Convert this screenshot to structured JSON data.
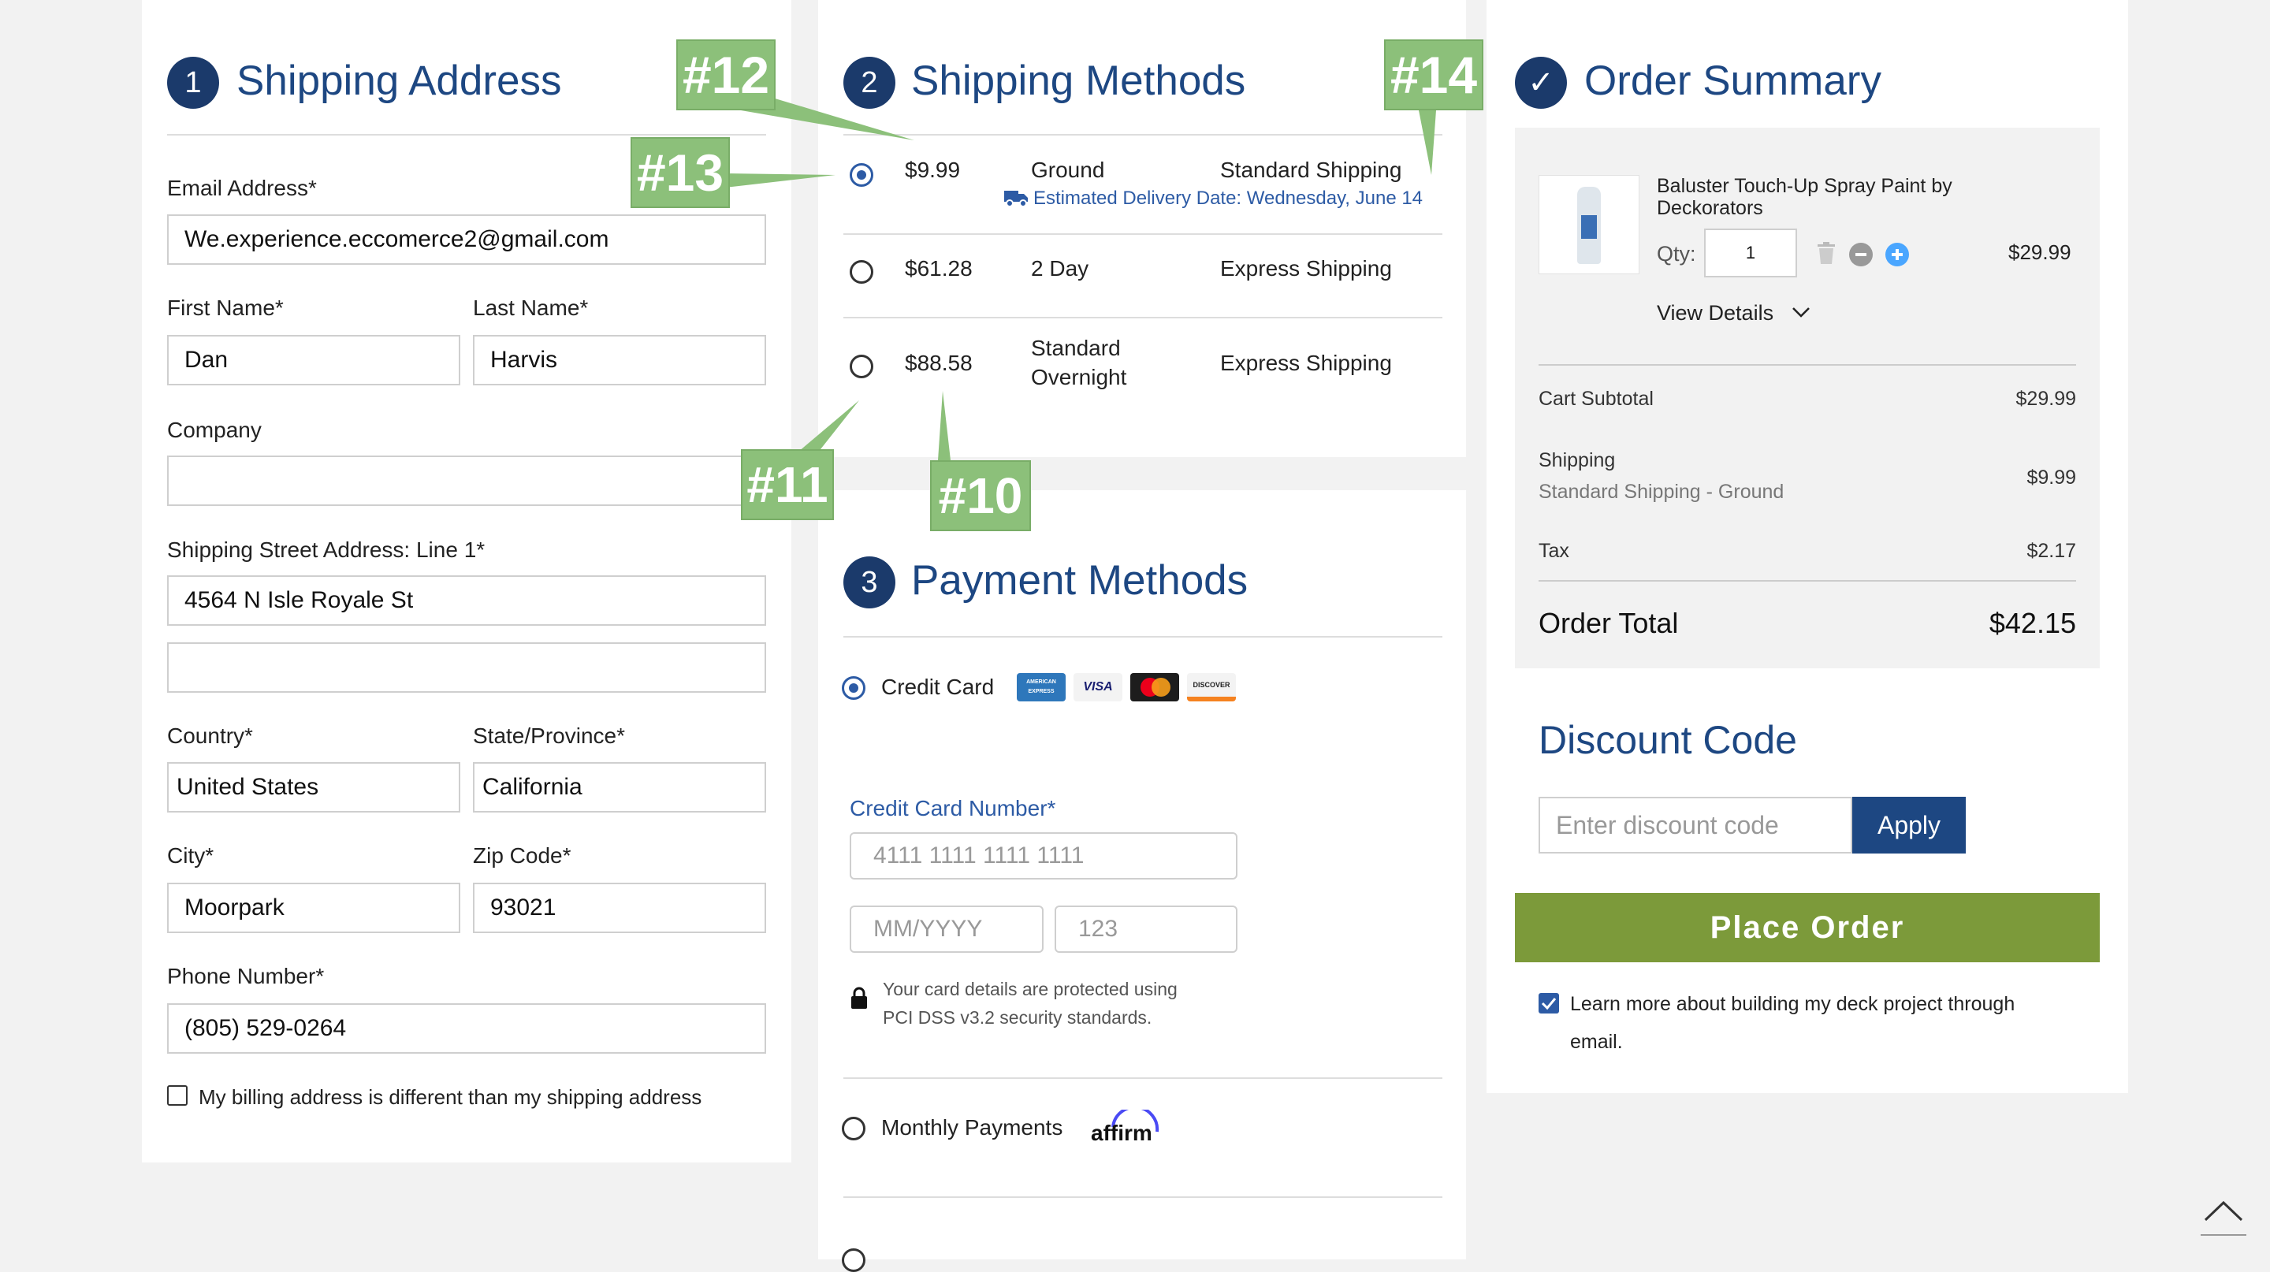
{
  "shipping_address": {
    "step": "1",
    "title": "Shipping Address",
    "email_label": "Email Address*",
    "email_value": "We.experience.eccomerce2@gmail.com",
    "first_name_label": "First Name*",
    "first_name_value": "Dan",
    "last_name_label": "Last Name*",
    "last_name_value": "Harvis",
    "company_label": "Company",
    "company_value": "",
    "street_label": "Shipping Street Address: Line 1*",
    "street_value": "4564 N Isle Royale St",
    "street2_value": "",
    "country_label": "Country*",
    "country_value": "United States",
    "state_label": "State/Province*",
    "state_value": "California",
    "city_label": "City*",
    "city_value": "Moorpark",
    "zip_label": "Zip Code*",
    "zip_value": "93021",
    "phone_label": "Phone Number*",
    "phone_value": "(805) 529-0264",
    "billing_checkbox_label": "My billing address is different than my shipping address"
  },
  "shipping_methods": {
    "step": "2",
    "title": "Shipping Methods",
    "options": [
      {
        "price": "$9.99",
        "speed": "Ground",
        "service": "Standard Shipping",
        "note": "Estimated Delivery Date: Wednesday, June 14",
        "selected": true
      },
      {
        "price": "$61.28",
        "speed": "2 Day",
        "service": "Express Shipping",
        "selected": false
      },
      {
        "price": "$88.58",
        "speed_line1": "Standard",
        "speed_line2": "Overnight",
        "service": "Express Shipping",
        "selected": false
      }
    ]
  },
  "payment_methods": {
    "step": "3",
    "title": "Payment Methods",
    "credit_card_label": "Credit Card",
    "card_logos": [
      "AMERICAN EXPRESS",
      "VISA",
      "mastercard",
      "DISCOVER"
    ],
    "cc_number_label": "Credit Card Number*",
    "cc_number_placeholder": "4111 1111 1111 1111",
    "expiry_placeholder": "MM/YYYY",
    "cvv_placeholder": "123",
    "security_note_line1": "Your card details are protected using",
    "security_note_line2": "PCI DSS v3.2 security standards.",
    "monthly_label": "Monthly Payments",
    "affirm_label": "affirm"
  },
  "order_summary": {
    "title": "Order Summary",
    "product_name_line1": "Baluster Touch-Up Spray Paint by",
    "product_name_line2": "Deckorators",
    "qty_label": "Qty:",
    "qty_value": "1",
    "item_price": "$29.99",
    "view_details": "View Details",
    "subtotal_label": "Cart Subtotal",
    "subtotal_value": "$29.99",
    "shipping_label": "Shipping",
    "shipping_method": "Standard Shipping - Ground",
    "shipping_value": "$9.99",
    "tax_label": "Tax",
    "tax_value": "$2.17",
    "total_label": "Order Total",
    "total_value": "$42.15"
  },
  "discount": {
    "title": "Discount Code",
    "placeholder": "Enter discount code",
    "apply_label": "Apply"
  },
  "place_order_label": "Place Order",
  "newsletter_line1": "Learn more about building my deck project through",
  "newsletter_line2": "email.",
  "callouts": [
    "#10",
    "#11",
    "#12",
    "#13",
    "#14"
  ],
  "colors": {
    "brand_navy": "#1b3a6b",
    "title_blue": "#1d4782",
    "place_order_green": "#7c9a3a",
    "callout_green": "#8cc07a"
  },
  "icons": [
    "check-icon",
    "truck-icon",
    "trash-icon",
    "minus-icon",
    "plus-icon",
    "chevron-down-icon",
    "lock-icon",
    "scroll-top-icon"
  ]
}
